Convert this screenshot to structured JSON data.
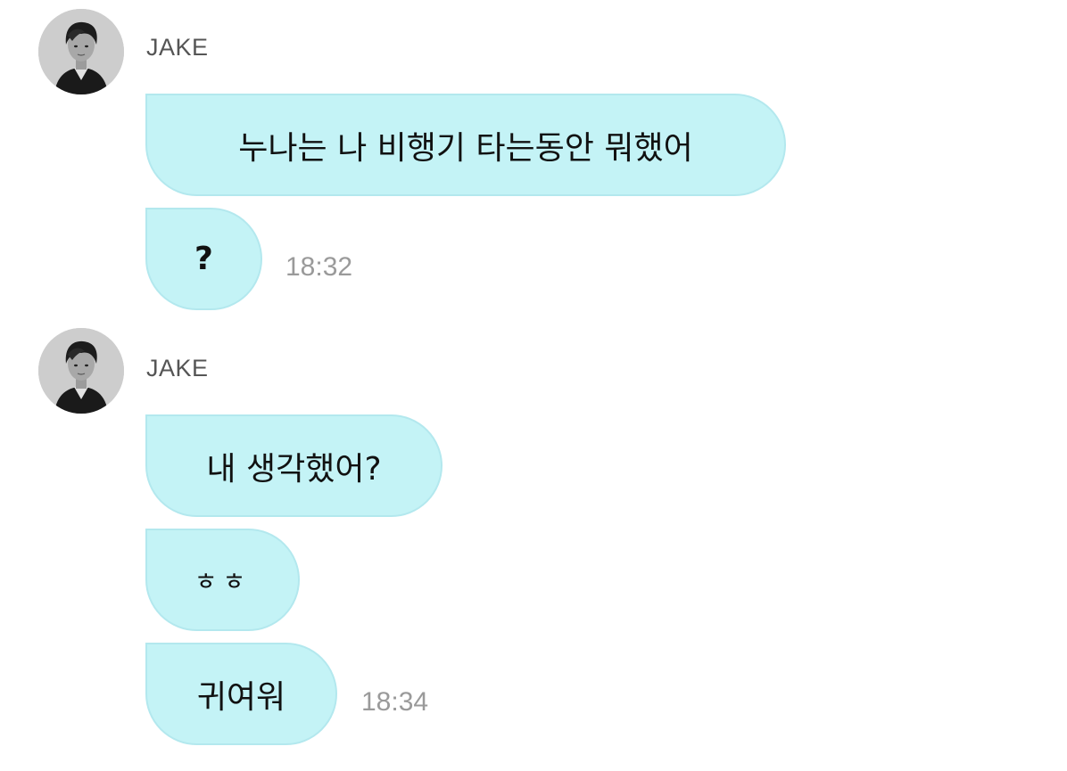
{
  "messages": [
    {
      "sender": "JAKE",
      "bubbles": [
        {
          "text": "누나는 나 비행기 타는동안 뭐했어"
        },
        {
          "text": "?",
          "time": "18:32"
        }
      ]
    },
    {
      "sender": "JAKE",
      "bubbles": [
        {
          "text": "내 생각했어?"
        },
        {
          "text": "ㅎㅎ"
        },
        {
          "text": "귀여워",
          "time": "18:34"
        }
      ]
    }
  ],
  "icons": {
    "avatar": "profile-photo-avatar-icon"
  },
  "colors": {
    "bubble_bg": "#c4f3f6",
    "bubble_border": "#b3e8ee",
    "sender_text": "#555555",
    "timestamp_text": "#9a9a9a"
  }
}
